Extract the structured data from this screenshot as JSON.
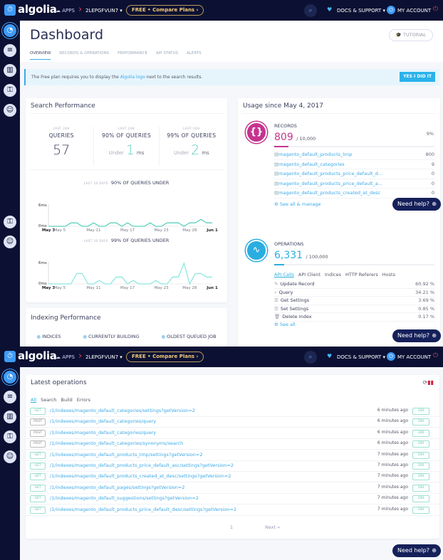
{
  "nav": {
    "brand": "algolia",
    "apps": "APPS",
    "app_id": "2LEPGFVUN7 ▾",
    "plan": "FREE • Compare Plans  ›",
    "docs": "DOCS & SUPPORT ▾",
    "account": "MY ACCOUNT"
  },
  "header": {
    "title": "Dashboard",
    "tutorial": "TUTORIAL",
    "tabs": [
      "OVERVIEW",
      "RECORDS & OPERATIONS",
      "PERFORMANCE",
      "API STATUS",
      "ALERTS"
    ]
  },
  "banner": {
    "text_before": "The Free plan requires you to display the ",
    "link": "Algolia logo",
    "text_after": " next to the search results.",
    "button": "YES I DID IT"
  },
  "search_perf": {
    "title": "Search Performance",
    "stats": [
      {
        "period": "LAST 24H",
        "label": "QUERIES",
        "prefix": "",
        "value": "57",
        "unit": ""
      },
      {
        "period": "LAST 24H",
        "label": "90% OF QUERIES",
        "prefix": "Under",
        "value": "1",
        "unit": "ms"
      },
      {
        "period": "LAST 24H",
        "label": "99% OF QUERIES",
        "prefix": "Under",
        "value": "2",
        "unit": "ms"
      }
    ]
  },
  "chart_data": [
    {
      "type": "line",
      "period": "LAST 30 DAYS",
      "title": "90% OF QUERIES UNDER",
      "ylabel": "ms",
      "yticks": [
        "6ms",
        "0ms"
      ],
      "ylim": [
        0,
        6
      ],
      "xticks": [
        "May 3",
        "May 5",
        "May 11",
        "May 17",
        "May 23",
        "May 28",
        "Jun 1"
      ],
      "values": [
        0,
        0,
        0,
        0,
        1,
        1,
        0,
        0,
        1,
        0,
        0,
        1,
        1,
        0,
        1,
        0,
        0,
        0,
        1,
        0,
        0,
        1,
        1,
        1,
        0,
        1,
        1,
        2,
        1,
        1
      ],
      "color": "#5ed1bd"
    },
    {
      "type": "line",
      "period": "LAST 30 DAYS",
      "title": "99% OF QUERIES UNDER",
      "ylabel": "ms",
      "yticks": [
        "6ms",
        "0ms"
      ],
      "ylim": [
        0,
        6
      ],
      "xticks": [
        "May 3",
        "May 5",
        "May 11",
        "May 17",
        "May 23",
        "May 28",
        "Jun 1"
      ],
      "values": [
        0,
        0,
        0,
        0,
        0,
        3,
        3,
        0,
        0,
        1,
        0,
        0,
        2,
        2,
        0,
        1,
        0,
        0,
        0,
        1,
        0,
        0,
        2,
        2,
        6,
        0,
        3,
        3,
        2,
        2
      ],
      "color": "#8de8e0"
    }
  ],
  "indexing": {
    "title": "Indexing Performance",
    "items": [
      "INDICES",
      "CURRENTLY BUILDING",
      "OLDEST QUEUED JOB"
    ]
  },
  "usage": {
    "title": "Usage since May 4, 2017",
    "records": {
      "label": "RECORDS",
      "value": "809",
      "limit": "/ 10,000",
      "percent": "9%",
      "fill": 0.09,
      "color": "#c5348e",
      "indices": [
        {
          "name": "magento_default_products_tmp",
          "count": "800"
        },
        {
          "name": "magento_default_categories",
          "count": "9"
        },
        {
          "name": "magento_default_products_price_default_d...",
          "count": "0"
        },
        {
          "name": "magento_default_products_price_default_a...",
          "count": "0"
        },
        {
          "name": "magento_default_products_created_at_desc",
          "count": "0"
        }
      ],
      "see_all": "See all & manage"
    },
    "operations": {
      "label": "OPERATIONS",
      "value": "6,331",
      "limit": "/ 100,000",
      "fill": 0.063,
      "color": "#2aaee0",
      "tabs": [
        "API Calls",
        "API Client",
        "Indices",
        "HTTP Referers",
        "Hosts"
      ],
      "items": [
        {
          "icon": "✎",
          "name": "Update Record",
          "pct": "60.92 %"
        },
        {
          "icon": "⌕",
          "name": "Query",
          "pct": "34.21 %"
        },
        {
          "icon": "☰",
          "name": "Get Settings",
          "pct": "3.69 %"
        },
        {
          "icon": "☰",
          "name": "Set Settings",
          "pct": "0.85 %"
        },
        {
          "icon": "🗑",
          "name": "Delete Index",
          "pct": "0.17 %"
        }
      ],
      "see_all": "See all"
    }
  },
  "help": "Need help?",
  "latest": {
    "title": "Latest operations",
    "filters": [
      "All",
      "Search",
      "Build",
      "Errors"
    ],
    "rows": [
      {
        "method": "GET",
        "path": "/1/indexes/magento_default_categories/settings?getVersion=2",
        "time": "6 minutes ago",
        "status": "200"
      },
      {
        "method": "POST",
        "path": "/1/indexes/magento_default_categories/query",
        "time": "6 minutes ago",
        "status": "200"
      },
      {
        "method": "POST",
        "path": "/1/indexes/magento_default_categories/query",
        "time": "6 minutes ago",
        "status": "200"
      },
      {
        "method": "POST",
        "path": "/1/indexes/magento_default_categories/synonyms/search",
        "time": "6 minutes ago",
        "status": "200"
      },
      {
        "method": "GET",
        "path": "/1/indexes/magento_default_products_tmp/settings?getVersion=2",
        "time": "7 minutes ago",
        "status": "200"
      },
      {
        "method": "GET",
        "path": "/1/indexes/magento_default_products_price_default_asc/settings?getVersion=2",
        "time": "7 minutes ago",
        "status": "200"
      },
      {
        "method": "GET",
        "path": "/1/indexes/magento_default_products_created_at_desc/settings?getVersion=2",
        "time": "7 minutes ago",
        "status": "200"
      },
      {
        "method": "GET",
        "path": "/1/indexes/magento_default_pages/settings?getVersion=2",
        "time": "7 minutes ago",
        "status": "200"
      },
      {
        "method": "GET",
        "path": "/1/indexes/magento_default_suggestions/settings?getVersion=2",
        "time": "7 minutes ago",
        "status": "200"
      },
      {
        "method": "GET",
        "path": "/1/indexes/magento_default_products_price_default_desc/settings?getVersion=2",
        "time": "7 minutes ago",
        "status": "200"
      }
    ],
    "page": "1",
    "next": "Next »"
  }
}
